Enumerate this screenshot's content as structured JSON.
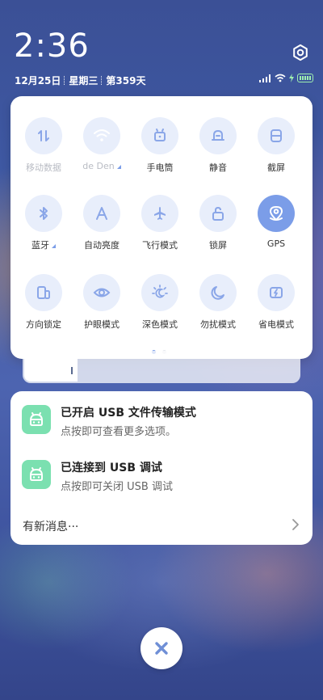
{
  "status_bar": {
    "time": "2:36",
    "date": "12月25日",
    "weekday": "星期三",
    "day_of_year": "第359天",
    "icons": [
      "signal-icon",
      "wifi-icon",
      "charging-icon",
      "battery-icon"
    ]
  },
  "settings_icon": "gear-icon",
  "quick_settings": {
    "tiles": [
      {
        "label": "移动数据",
        "icon": "mobile-data-icon",
        "active": false,
        "disabled": true
      },
      {
        "label": "de   Den",
        "icon": "wifi-icon",
        "active": true,
        "has_more": true
      },
      {
        "label": "手电筒",
        "icon": "flashlight-icon",
        "active": false
      },
      {
        "label": "静音",
        "icon": "mute-bell-icon",
        "active": false
      },
      {
        "label": "截屏",
        "icon": "screenshot-icon",
        "active": false
      },
      {
        "label": "蓝牙",
        "icon": "bluetooth-icon",
        "active": false,
        "has_more": true
      },
      {
        "label": "自动亮度",
        "icon": "auto-brightness-icon",
        "active": false
      },
      {
        "label": "飞行模式",
        "icon": "airplane-icon",
        "active": false
      },
      {
        "label": "锁屏",
        "icon": "lock-icon",
        "active": false
      },
      {
        "label": "GPS",
        "icon": "location-icon",
        "active": true
      },
      {
        "label": "方向锁定",
        "icon": "rotation-lock-icon",
        "active": false
      },
      {
        "label": "护眼模式",
        "icon": "eye-icon",
        "active": false
      },
      {
        "label": "深色模式",
        "icon": "dark-mode-icon",
        "active": false
      },
      {
        "label": "勿扰模式",
        "icon": "moon-icon",
        "active": false
      },
      {
        "label": "省电模式",
        "icon": "battery-saver-icon",
        "active": false
      }
    ],
    "pages": 2,
    "current_page": 1
  },
  "notifications": [
    {
      "title": "已开启 USB 文件传输模式",
      "subtitle": "点按即可查看更多选项。",
      "icon": "android-icon"
    },
    {
      "title": "已连接到 USB 调试",
      "subtitle": "点按即可关闭 USB 调试",
      "icon": "android-icon"
    }
  ],
  "more_messages": "有新消息···",
  "colors": {
    "accent": "#7b9de8",
    "tile_bg": "#e8eefb",
    "app_icon": "#7be0b0"
  }
}
